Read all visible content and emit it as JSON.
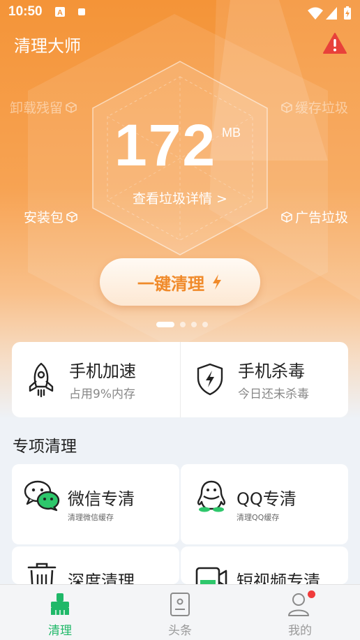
{
  "status_bar": {
    "time": "10:50"
  },
  "header": {
    "title": "清理大师"
  },
  "hex": {
    "top_left": "卸载残留",
    "top_right": "缓存垃圾",
    "bottom_left": "安装包",
    "bottom_right": "广告垃圾"
  },
  "junk": {
    "size": "172",
    "unit": "MB",
    "detail_link": "查看垃圾详情 >"
  },
  "clean_button": {
    "label": "一键清理"
  },
  "carousel": {
    "pages": 4,
    "active": 0
  },
  "quick": [
    {
      "title": "手机加速",
      "subtitle": "占用9%内存",
      "icon": "rocket-icon"
    },
    {
      "title": "手机杀毒",
      "subtitle": "今日还未杀毒",
      "icon": "shield-bolt-icon"
    }
  ],
  "section": {
    "title": "专项清理"
  },
  "special": [
    {
      "title": "微信专清",
      "subtitle": "清理微信缓存",
      "icon": "wechat-icon"
    },
    {
      "title": "QQ专清",
      "subtitle": "清理QQ缓存",
      "icon": "qq-icon"
    },
    {
      "title": "深度清理",
      "subtitle": "",
      "icon": "trash-icon"
    },
    {
      "title": "短视频专清",
      "subtitle": "",
      "icon": "video-icon"
    }
  ],
  "nav": [
    {
      "label": "清理",
      "icon": "broom-icon",
      "active": true
    },
    {
      "label": "头条",
      "icon": "news-icon",
      "active": false
    },
    {
      "label": "我的",
      "icon": "profile-icon",
      "active": false,
      "badge": true
    }
  ],
  "colors": {
    "accent_orange": "#f08a2a",
    "accent_green": "#1fb868",
    "warning_red": "#e8413a"
  }
}
